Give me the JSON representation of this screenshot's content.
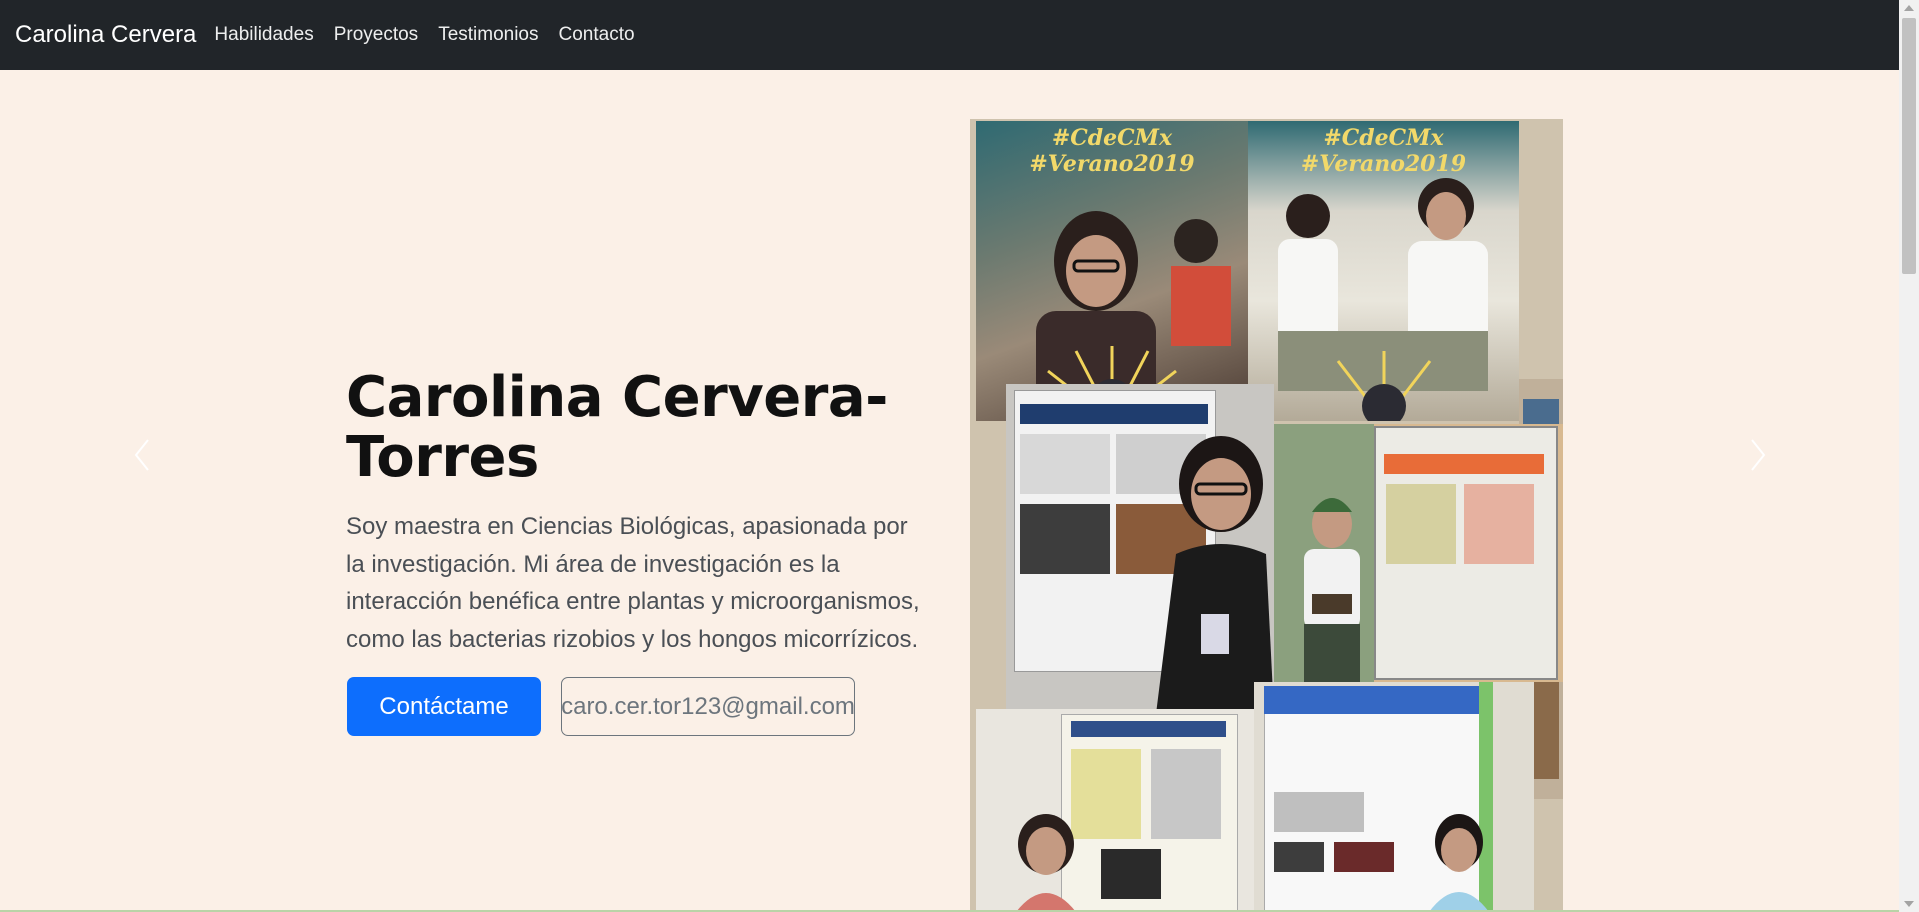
{
  "navbar": {
    "brand": "Carolina Cervera",
    "links": [
      "Habilidades",
      "Proyectos",
      "Testimonios",
      "Contacto"
    ]
  },
  "hero": {
    "title": "Carolina Cervera-Torres",
    "description": "Soy maestra en Ciencias Biológicas, apasionada por la investigación. Mi área de investigación es la interacción benéfica entre plantas y microorganismos, como las bacterias rizobios y los hongos micorrízicos.",
    "primary_button": "Contáctame",
    "email_button": "caro.cer.tor123@gmail.com"
  },
  "collage": {
    "banner_text": "#CdeCMx #Verano2019"
  },
  "colors": {
    "navbar_bg": "#212529",
    "page_bg": "#fbf0e7",
    "primary": "#0d6efd",
    "outline": "#6c757d"
  },
  "icons": {
    "carousel_prev": "chevron-left-icon",
    "carousel_next": "chevron-right-icon"
  }
}
